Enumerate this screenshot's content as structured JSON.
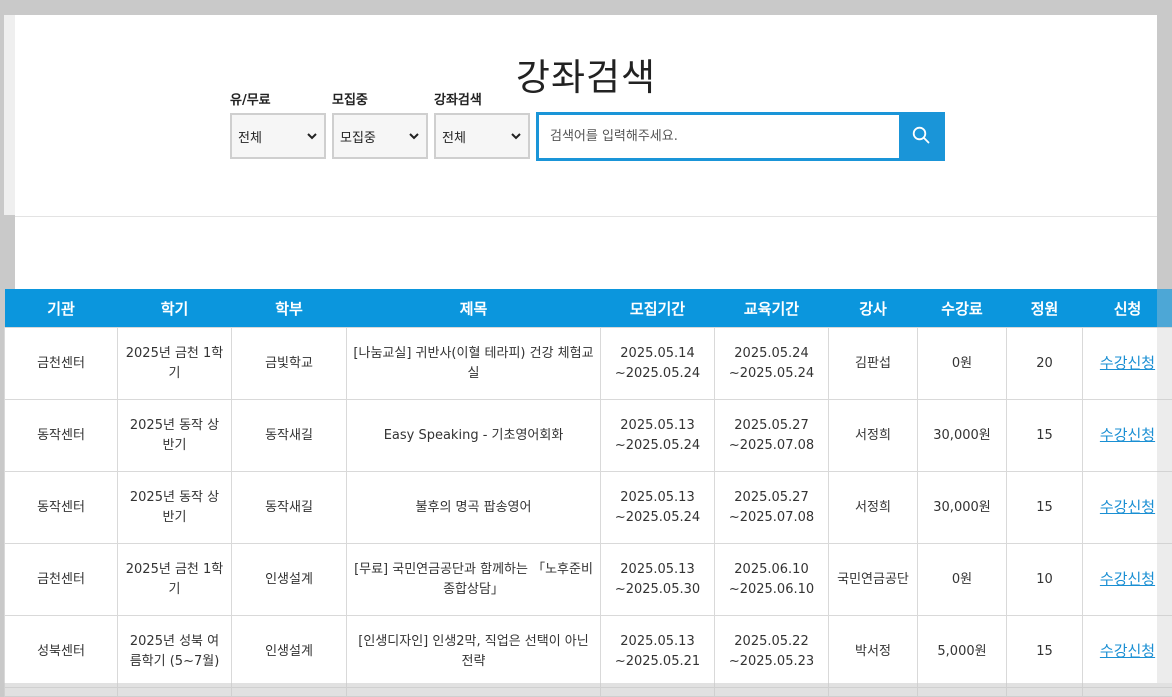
{
  "page_title": "강좌검색",
  "filters": {
    "fee": {
      "label": "유/무료",
      "selected": "전체"
    },
    "status": {
      "label": "모집중",
      "selected": "모집중"
    },
    "search_type": {
      "label": "강좌검색",
      "selected": "전체"
    }
  },
  "search": {
    "placeholder": "검색어를 입력해주세요.",
    "value": ""
  },
  "table": {
    "headers": [
      "기관",
      "학기",
      "학부",
      "제목",
      "모집기간",
      "교육기간",
      "강사",
      "수강료",
      "정원",
      "신청"
    ],
    "rows": [
      {
        "org": "금천센터",
        "term": "2025년 금천 1학기",
        "dept": "금빛학교",
        "title": "[나눔교실] 귀반사(이혈 테라피) 건강 체험교실",
        "recruit": "2025.05.14 ~2025.05.24",
        "edu": "2025.05.24 ~2025.05.24",
        "teacher": "김판섭",
        "fee": "0원",
        "capacity": "20",
        "apply": "수강신청"
      },
      {
        "org": "동작센터",
        "term": "2025년 동작 상반기",
        "dept": "동작새길",
        "title": "Easy Speaking - 기초영어회화",
        "recruit": "2025.05.13 ~2025.05.24",
        "edu": "2025.05.27 ~2025.07.08",
        "teacher": "서정희",
        "fee": "30,000원",
        "capacity": "15",
        "apply": "수강신청"
      },
      {
        "org": "동작센터",
        "term": "2025년 동작 상반기",
        "dept": "동작새길",
        "title": "불후의 명곡 팝송영어",
        "recruit": "2025.05.13 ~2025.05.24",
        "edu": "2025.05.27 ~2025.07.08",
        "teacher": "서정희",
        "fee": "30,000원",
        "capacity": "15",
        "apply": "수강신청"
      },
      {
        "org": "금천센터",
        "term": "2025년 금천 1학기",
        "dept": "인생설계",
        "title": "[무료] 국민연금공단과 함께하는 「노후준비 종합상담」",
        "recruit": "2025.05.13 ~2025.05.30",
        "edu": "2025.06.10 ~2025.06.10",
        "teacher": "국민연금공단",
        "fee": "0원",
        "capacity": "10",
        "apply": "수강신청"
      },
      {
        "org": "성북센터",
        "term": "2025년 성북 여름학기 (5~7월)",
        "dept": "인생설계",
        "title": "[인생디자인] 인생2막, 직업은 선택이 아닌 전략",
        "recruit": "2025.05.13 ~2025.05.21",
        "edu": "2025.05.22 ~2025.05.23",
        "teacher": "박서정",
        "fee": "5,000원",
        "capacity": "15",
        "apply": "수강신청"
      }
    ]
  },
  "colors": {
    "accent": "#0b96dd",
    "link": "#1a8fd3",
    "backdrop": "#c9c9c9"
  },
  "icons": {
    "search": "search-icon",
    "dropdown": "chevron-down-icon"
  }
}
